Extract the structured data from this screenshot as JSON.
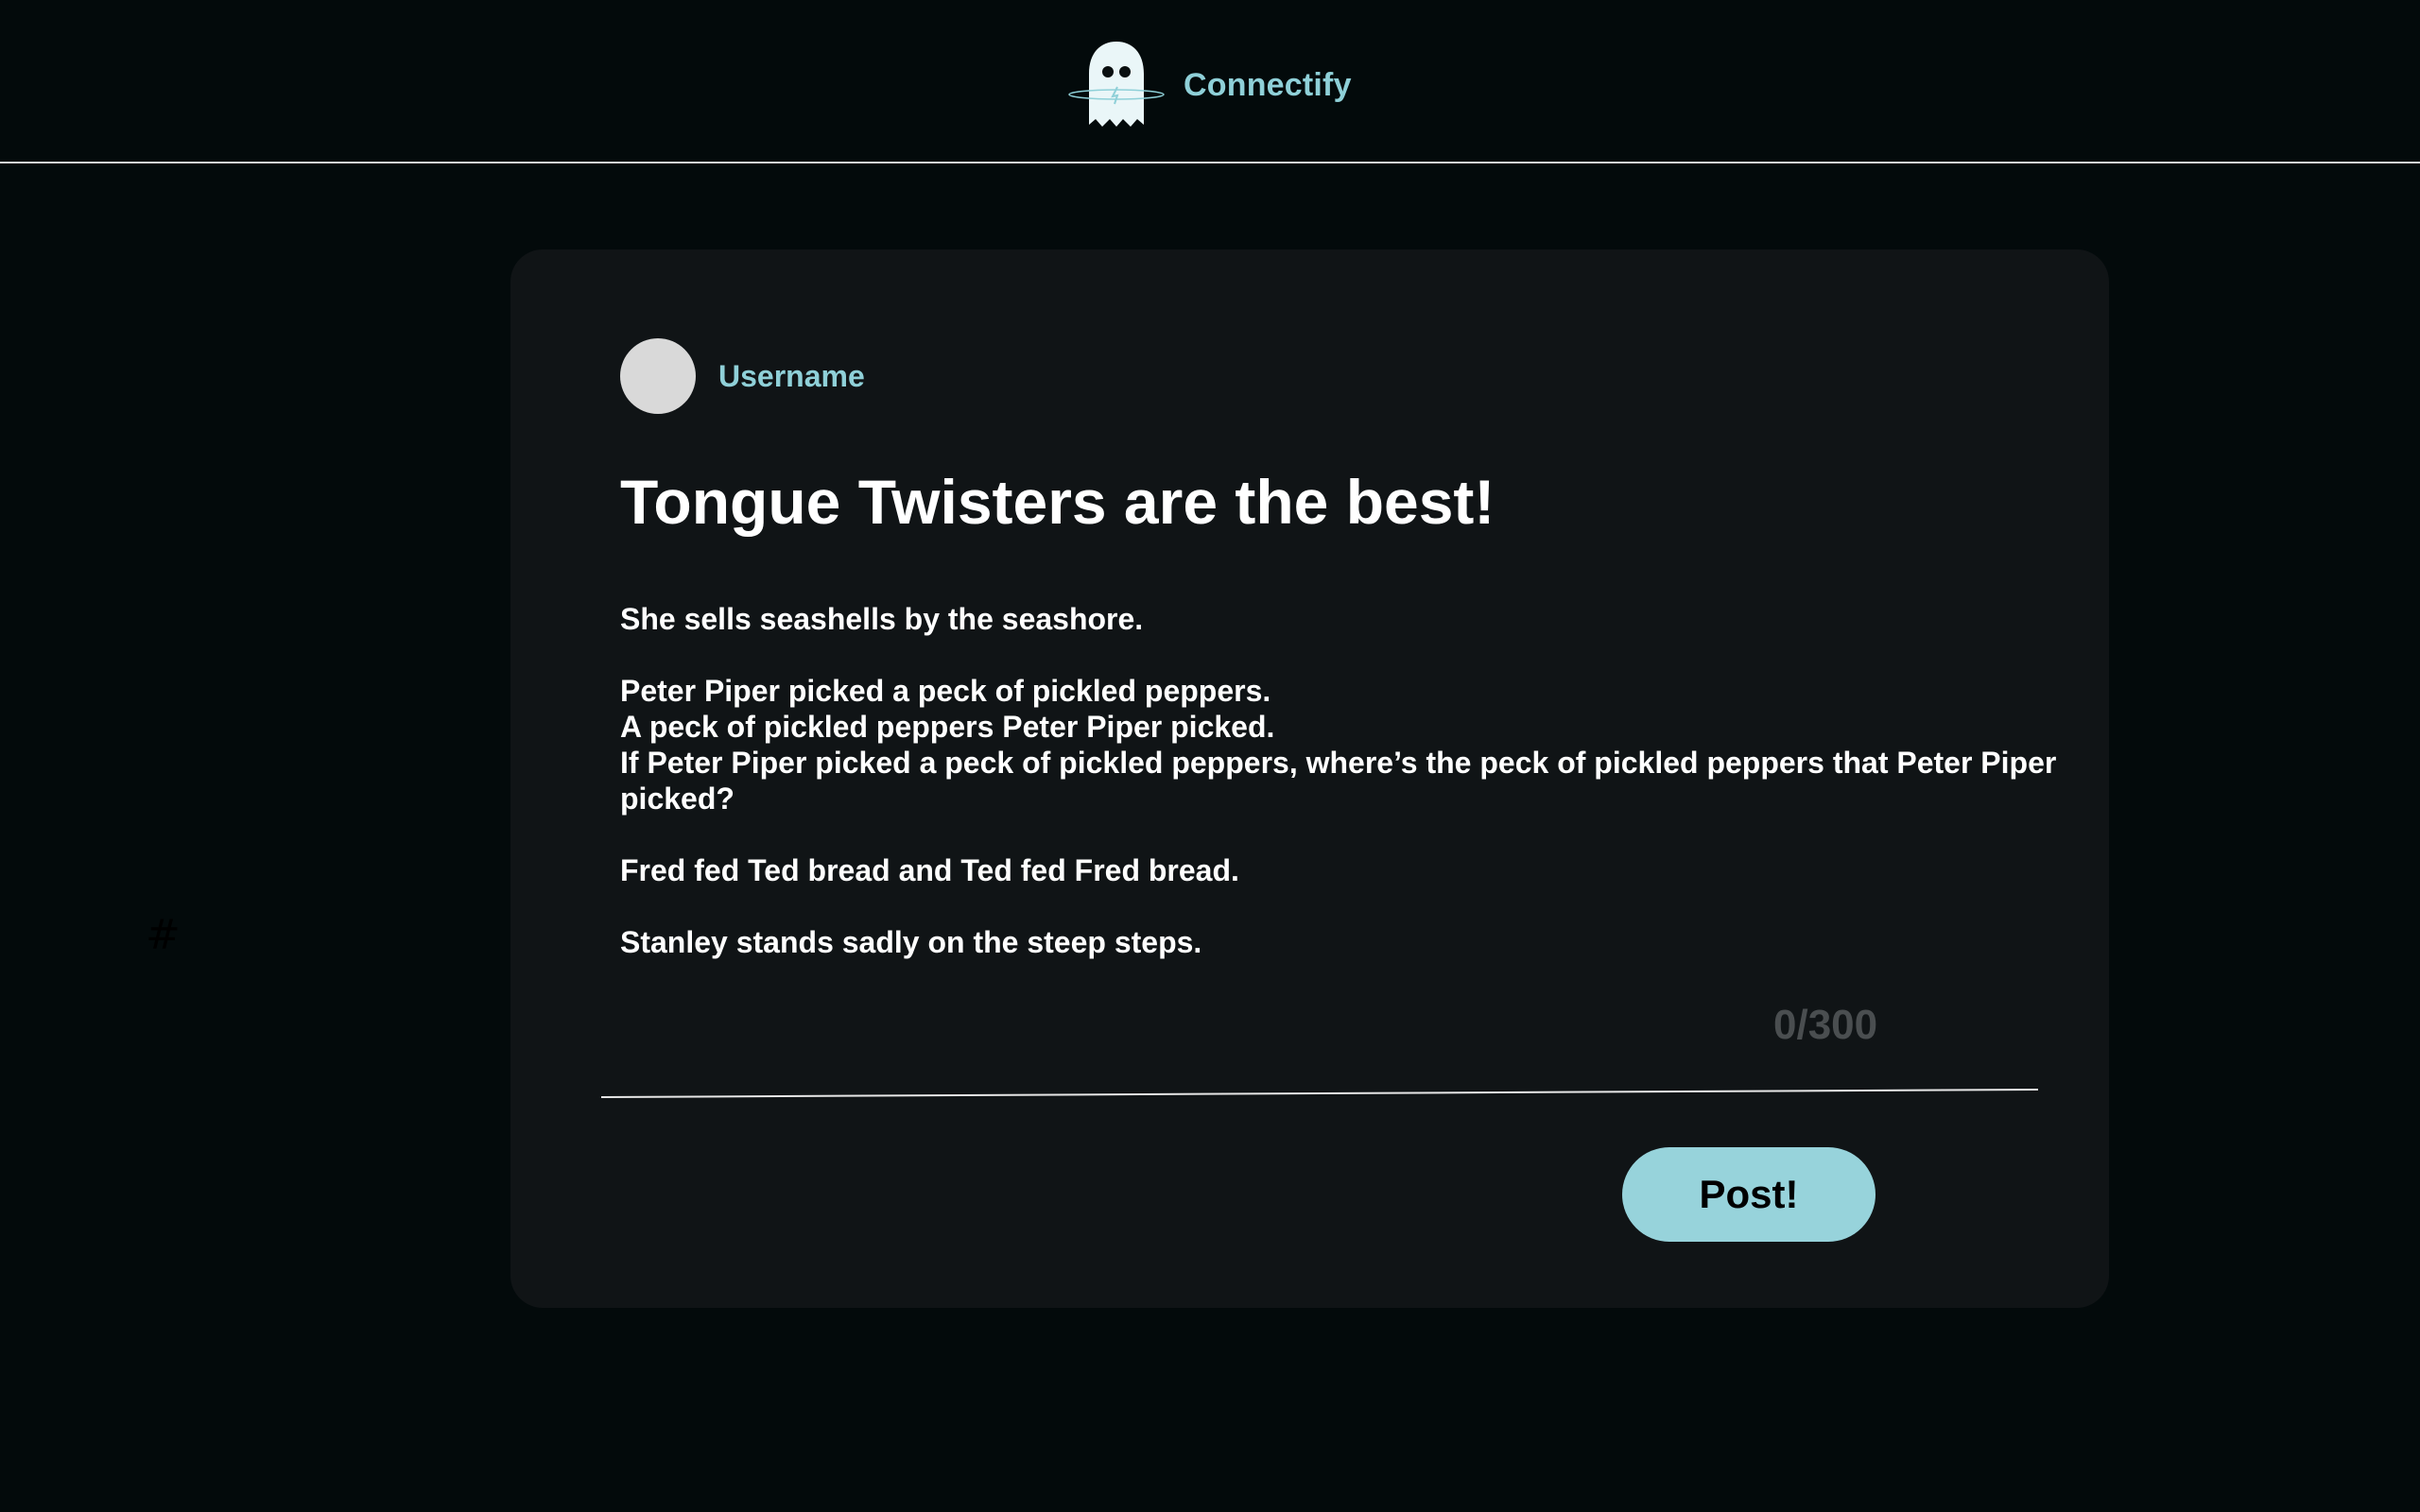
{
  "header": {
    "app_name": "Connectify",
    "logo_icon": "ghost-icon"
  },
  "sidebar": {
    "hash_icon": "hash-icon",
    "hash_glyph": "#"
  },
  "post": {
    "username": "Username",
    "title": "Tongue Twisters are the best!",
    "paragraphs": [
      "She sells seashells by the seashore.",
      "Peter Piper picked a peck of pickled peppers.\nA peck of pickled peppers Peter Piper picked.\nIf Peter Piper picked a peck of pickled peppers, where’s the peck of pickled peppers that Peter Piper picked?",
      "Fred fed Ted bread and Ted fed Fred bread.",
      "Stanley stands sadly on the steep steps."
    ],
    "char_count": "0/300",
    "post_button_label": "Post!"
  },
  "colors": {
    "background": "#030a0b",
    "card": "#101416",
    "accent": "#8fd0d8",
    "button": "#97d3db",
    "avatar": "#d9d9d9",
    "counter": "#4a4e50"
  }
}
